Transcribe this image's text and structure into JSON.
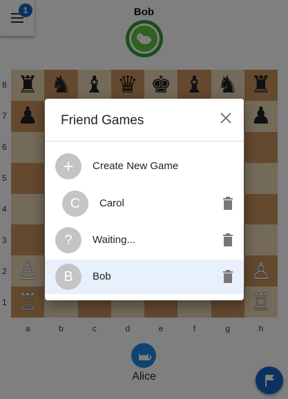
{
  "menu": {
    "badge_count": "1"
  },
  "opponent": {
    "name": "Bob"
  },
  "self": {
    "name": "Alice"
  },
  "board": {
    "ranks": [
      "8",
      "7",
      "6",
      "5",
      "4",
      "3",
      "2",
      "1"
    ],
    "files": [
      "a",
      "b",
      "c",
      "d",
      "e",
      "f",
      "g",
      "h"
    ],
    "pieces": [
      [
        "♜",
        "♞",
        "♝",
        "♛",
        "♚",
        "♝",
        "♞",
        "♜"
      ],
      [
        "♟",
        "",
        "",
        "",
        "",
        "",
        "",
        "♟"
      ],
      [
        "",
        "",
        "",
        "",
        "",
        "",
        "",
        ""
      ],
      [
        "",
        "",
        "",
        "",
        "",
        "",
        "",
        ""
      ],
      [
        "",
        "",
        "",
        "",
        "",
        "",
        "",
        ""
      ],
      [
        "",
        "",
        "",
        "",
        "",
        "",
        "",
        ""
      ],
      [
        "♙",
        "",
        "",
        "",
        "",
        "",
        "",
        "♙"
      ],
      [
        "♖",
        "",
        "",
        "",
        "",
        "",
        "",
        "♖"
      ]
    ]
  },
  "dialog": {
    "title": "Friend Games",
    "items": [
      {
        "avatar": "+",
        "label": "Create New Game"
      },
      {
        "avatar": "C",
        "label": "Carol"
      },
      {
        "avatar": "?",
        "label": "Waiting..."
      },
      {
        "avatar": "B",
        "label": "Bob"
      }
    ]
  },
  "icons": {
    "menu": "hamburger-icon",
    "opponent_avatar": "hamster-icon",
    "self_avatar": "cat-icon",
    "close": "close-icon",
    "delete": "trash-icon",
    "resign": "flag-icon"
  },
  "colors": {
    "accent": "#1565c0",
    "opponent_avatar": "#61c23f",
    "light_square": "#e8d4b4",
    "dark_square": "#c8935f",
    "selected_row": "#e8f0fb"
  }
}
